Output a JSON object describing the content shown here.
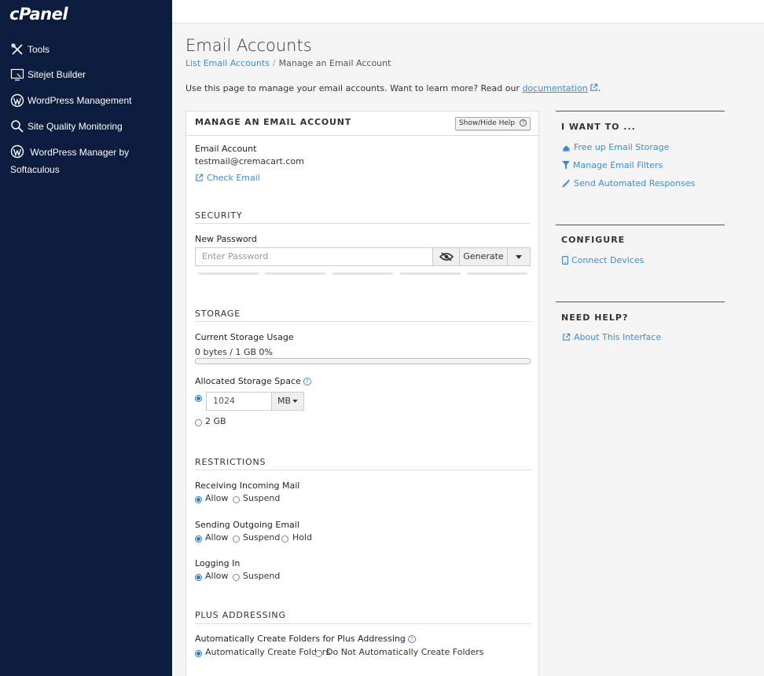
{
  "brand": {
    "logo": "cPanel",
    "sidebar_bg": "#0b1c3f",
    "accent": "#428bca"
  },
  "sidebar": {
    "items": [
      {
        "label": "Tools",
        "icon": "tools-icon"
      },
      {
        "label": "Sitejet Builder",
        "icon": "sitejet-icon"
      },
      {
        "label": "WordPress Management",
        "icon": "wordpress-icon"
      },
      {
        "label": "Site Quality Monitoring",
        "icon": "magnifier-icon"
      },
      {
        "label": "WordPress Manager by Softaculous",
        "icon": "wordpress-icon"
      }
    ]
  },
  "header": {
    "title": "Email Accounts",
    "breadcrumb": {
      "link": "List Email Accounts",
      "separator": "/",
      "current": "Manage an Email Account"
    },
    "intro_text": "Use this page to manage your email accounts. Want to learn more? Read our ",
    "intro_link": "documentation",
    "intro_end": "."
  },
  "panel": {
    "title": "MANAGE AN EMAIL ACCOUNT",
    "help_button": "Show/Hide Help",
    "account": {
      "label": "Email Account",
      "value": "testmail@cremacart.com",
      "check_link": "Check Email"
    },
    "security": {
      "heading": "SECURITY",
      "password_label": "New Password",
      "password_placeholder": "Enter Password",
      "generate_label": "Generate"
    },
    "storage": {
      "heading": "STORAGE",
      "usage_label": "Current Storage Usage",
      "usage_value": "0 bytes / 1 GB 0%",
      "usage_fraction": 0,
      "allocated_label": "Allocated Storage Space",
      "quota_value": "1024",
      "unit": "MB",
      "alt_option": "2 GB",
      "selected": "custom"
    },
    "restrictions": {
      "heading": "RESTRICTIONS",
      "incoming": {
        "label": "Receiving Incoming Mail",
        "options": [
          "Allow",
          "Suspend"
        ],
        "selected": "Allow"
      },
      "outgoing": {
        "label": "Sending Outgoing Email",
        "options": [
          "Allow",
          "Suspend",
          "Hold"
        ],
        "selected": "Allow"
      },
      "login": {
        "label": "Logging In",
        "options": [
          "Allow",
          "Suspend"
        ],
        "selected": "Allow"
      }
    },
    "plus": {
      "heading": "PLUS ADDRESSING",
      "label": "Automatically Create Folders for Plus Addressing",
      "options": [
        "Automatically Create Folders",
        "Do Not Automatically Create Folders"
      ],
      "selected": "Automatically Create Folders"
    }
  },
  "aside": {
    "i_want_to": {
      "heading": "I WANT TO ...",
      "links": [
        "Free up Email Storage",
        "Manage Email Filters",
        "Send Automated Responses"
      ]
    },
    "configure": {
      "heading": "CONFIGURE",
      "links": [
        "Connect Devices"
      ]
    },
    "need_help": {
      "heading": "NEED HELP?",
      "links": [
        "About This Interface"
      ]
    }
  }
}
